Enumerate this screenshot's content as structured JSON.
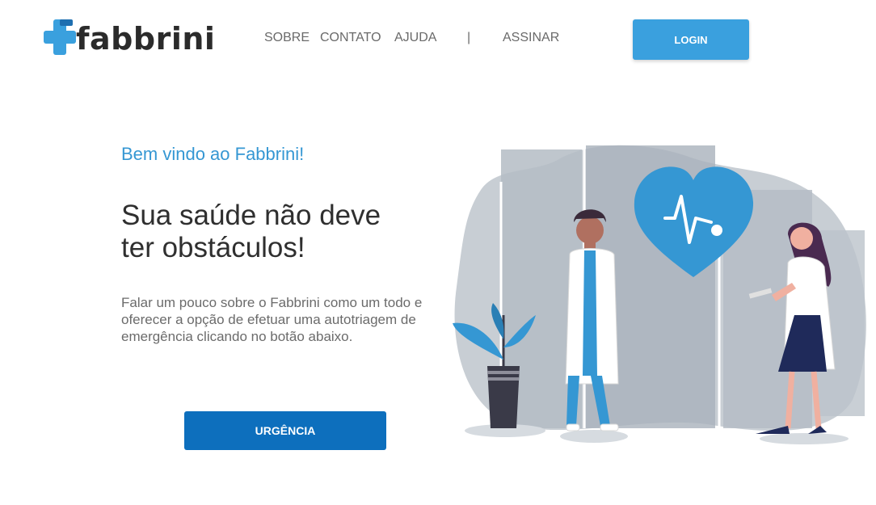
{
  "brand": {
    "name": "fabbrini",
    "accent_color": "#3aa0de",
    "logo_icon": "medical-cross-icon"
  },
  "nav": {
    "items": [
      {
        "label": "SOBRE"
      },
      {
        "label": "CONTATO"
      },
      {
        "label": "AJUDA"
      },
      {
        "label": "ASSINAR"
      }
    ],
    "separator": "|",
    "login_label": "LOGIN"
  },
  "hero": {
    "welcome": "Bem vindo ao Fabbrini!",
    "headline_line1": "Sua saúde não deve",
    "headline_line2": "ter obstáculos!",
    "description": "Falar um pouco sobre o Fabbrini como um todo e oferecer a opção de efetuar uma autotriagem de emergência clicando no botão abaixo.",
    "cta_label": "URGÊNCIA",
    "cta_color": "#0d6fbd"
  },
  "illustration": {
    "subject": "doctors-with-heart-icon",
    "heart_color": "#3597d3"
  }
}
